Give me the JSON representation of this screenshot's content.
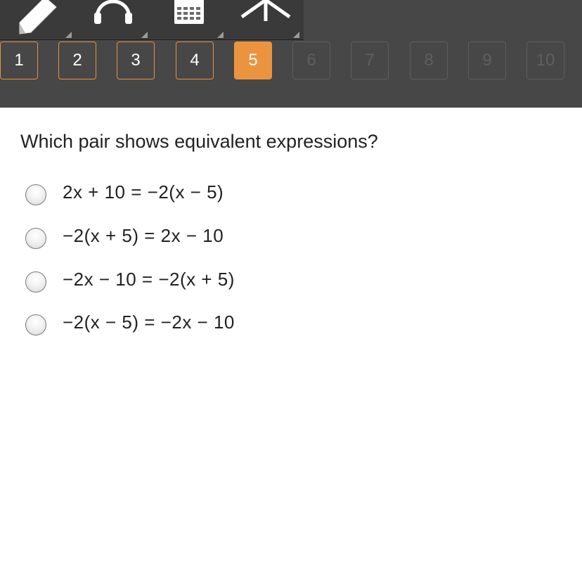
{
  "toolbar": {
    "tools": [
      {
        "icon": "pencil-icon"
      },
      {
        "icon": "headphones-icon"
      },
      {
        "icon": "calculator-icon"
      },
      {
        "icon": "reference-icon"
      }
    ]
  },
  "question_nav": {
    "items": [
      {
        "label": "1",
        "state": "answered"
      },
      {
        "label": "2",
        "state": "answered"
      },
      {
        "label": "3",
        "state": "answered"
      },
      {
        "label": "4",
        "state": "answered"
      },
      {
        "label": "5",
        "state": "current"
      },
      {
        "label": "6",
        "state": "locked"
      },
      {
        "label": "7",
        "state": "locked"
      },
      {
        "label": "8",
        "state": "locked"
      },
      {
        "label": "9",
        "state": "locked"
      },
      {
        "label": "10",
        "state": "locked"
      }
    ],
    "accent_color": "#eb9440"
  },
  "question": {
    "text": "Which pair shows equivalent expressions?",
    "options": [
      {
        "expression": "2x + 10 = −2(x − 5)"
      },
      {
        "expression": "−2(x + 5) = 2x − 10"
      },
      {
        "expression": "−2x − 10 = −2(x + 5)"
      },
      {
        "expression": "−2(x − 5) = −2x − 10"
      }
    ]
  }
}
